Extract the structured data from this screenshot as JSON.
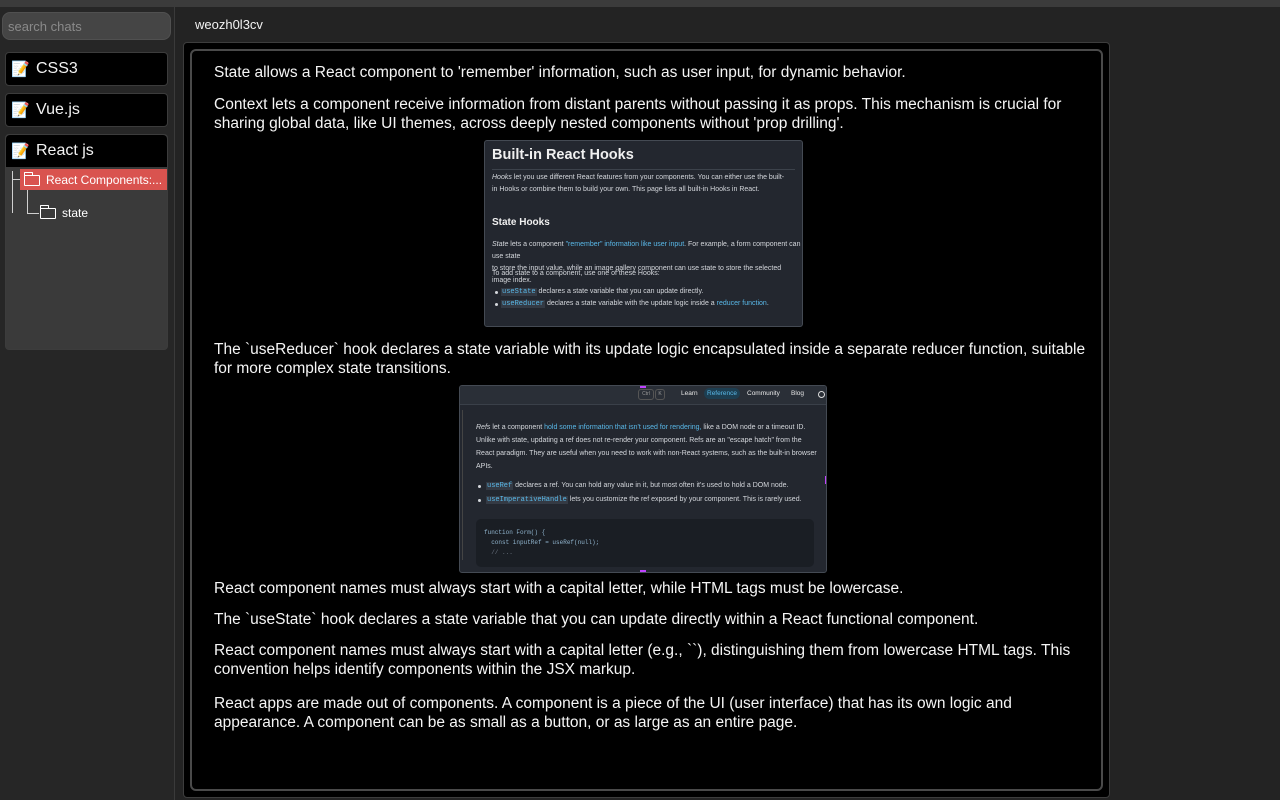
{
  "sidebar": {
    "search": {
      "placeholder": "search chats",
      "value": ""
    },
    "chats": [
      {
        "emoji": "📝",
        "title": "CSS3"
      },
      {
        "emoji": "📝",
        "title": "Vue.js"
      },
      {
        "emoji": "📝",
        "title": "React js",
        "expanded": true,
        "nodes": [
          {
            "label": "React Components:...",
            "selected": true
          },
          {
            "label": "state",
            "selected": false
          }
        ]
      }
    ]
  },
  "room": {
    "title": "weozh0l3cv"
  },
  "messages": [
    "State allows a React component to 'remember' information, such as user input, for dynamic behavior.",
    "Context lets a component receive information from distant parents without passing it as props. This mechanism is crucial for sharing global data, like UI themes, across deeply nested components without 'prop drilling'.",
    "The `useReducer` hook declares a state variable with its update logic encapsulated inside a separate reducer function, suitable for more complex state transitions.",
    "React component names must always start with a capital letter, while HTML tags must be lowercase.",
    "The `useState` hook declares a state variable that you can update directly within a React functional component.",
    "React component names must always start with a capital letter (e.g., ``), distinguishing them from lowercase HTML tags. This convention helps identify components within the JSX markup.",
    "React apps are made out of components. A component is a piece of the UI (user interface) that has its own logic and appearance. A component can be as small as a button, or as large as an entire page."
  ],
  "screenshot1": {
    "title": "Built-in React Hooks",
    "p1_em": "Hooks",
    "p1_a": " let you use different React features from your components. You can either use the built-",
    "p1_b": "in Hooks or combine them to build your own. This page lists all built-in Hooks in React.",
    "h2": "State Hooks",
    "p2_em": "State",
    "p2_a": " lets a component ",
    "p2_link": "\"remember\" information like user input",
    "p2_b": ". For example, a form component can use state",
    "p2_c": "to store the input value, while an image gallery component can use state to store the selected image index.",
    "p3": "To add state to a component, use one of these Hooks:",
    "li1_code": "useState",
    "li1_text": " declares a state variable that you can update directly.",
    "li2_code": "useReducer",
    "li2_text": " declares a state variable with the update logic inside a ",
    "li2_link": "reducer function",
    "li2_end": "."
  },
  "screenshot2": {
    "kbd1": "Ctrl",
    "kbd2": "K",
    "nav_learn": "Learn",
    "nav_reference": "Reference",
    "nav_community": "Community",
    "nav_blog": "Blog",
    "p1_em": "Refs",
    "p1_a": " let a component ",
    "p1_link": "hold some information that isn't used for rendering,",
    "p1_b": " like a DOM node or a timeout ID.",
    "p1_c": "Unlike with state, updating a ref does not re-render your component. Refs are an \"escape hatch\" from the",
    "p1_d": "React paradigm. They are useful when you need to work with non-React systems, such as the built-in browser",
    "p1_e": "APIs.",
    "li1_code": "useRef",
    "li1_text": " declares a ref. You can hold any value in it, but most often it's used to hold a DOM node.",
    "li2_code": "useImperativeHandle",
    "li2_text": " lets you customize the ref exposed by your component. This is rarely used.",
    "code1": "function Form() {",
    "code2": "  const inputRef = useRef(null);",
    "code3": "  // ..."
  }
}
